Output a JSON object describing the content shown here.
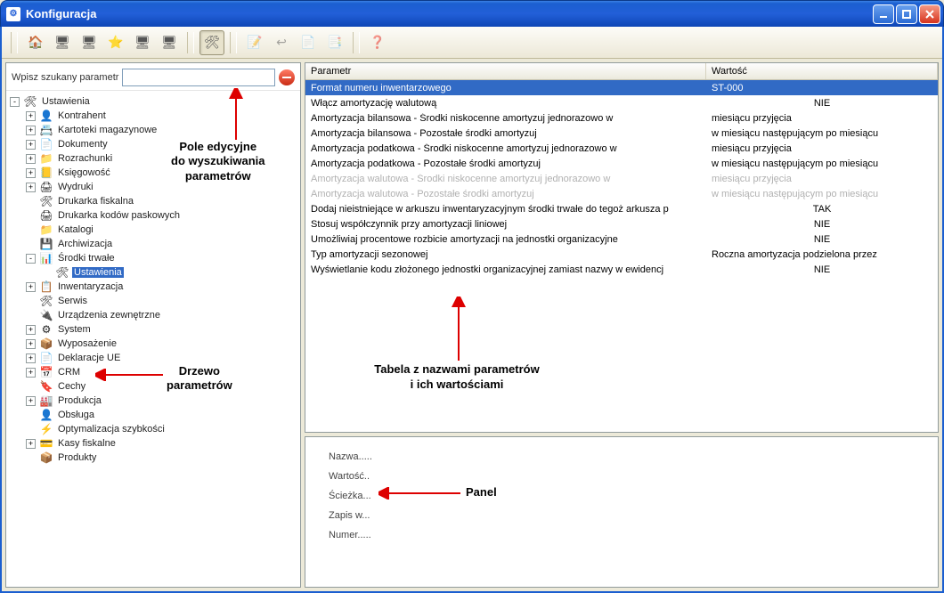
{
  "window": {
    "title": "Konfiguracja"
  },
  "search": {
    "label": "Wpisz szukany parametr",
    "value": ""
  },
  "tree": {
    "root": "Ustawienia",
    "items": [
      {
        "label": "Kontrahent",
        "icon": "👤",
        "exp": "+"
      },
      {
        "label": "Kartoteki magazynowe",
        "icon": "📇",
        "exp": "+"
      },
      {
        "label": "Dokumenty",
        "icon": "📄",
        "exp": "+"
      },
      {
        "label": "Rozrachunki",
        "icon": "📁",
        "exp": "+"
      },
      {
        "label": "Księgowość",
        "icon": "📒",
        "exp": "+"
      },
      {
        "label": "Wydruki",
        "icon": "🖨",
        "exp": "+"
      },
      {
        "label": "Drukarka fiskalna",
        "icon": "🛠",
        "exp": ""
      },
      {
        "label": "Drukarka kodów paskowych",
        "icon": "🖨",
        "exp": ""
      },
      {
        "label": "Katalogi",
        "icon": "📁",
        "exp": ""
      },
      {
        "label": "Archiwizacja",
        "icon": "💾",
        "exp": ""
      },
      {
        "label": "Środki trwałe",
        "icon": "📊",
        "exp": "-",
        "children": [
          {
            "label": "Ustawienia",
            "icon": "🛠",
            "selected": true
          }
        ]
      },
      {
        "label": "Inwentaryzacja",
        "icon": "📋",
        "exp": "+"
      },
      {
        "label": "Serwis",
        "icon": "🛠",
        "exp": ""
      },
      {
        "label": "Urządzenia zewnętrzne",
        "icon": "🔌",
        "exp": ""
      },
      {
        "label": "System",
        "icon": "⚙",
        "exp": "+"
      },
      {
        "label": "Wyposażenie",
        "icon": "📦",
        "exp": "+"
      },
      {
        "label": "Deklaracje UE",
        "icon": "📄",
        "exp": "+"
      },
      {
        "label": "CRM",
        "icon": "📅",
        "exp": "+"
      },
      {
        "label": "Cechy",
        "icon": "🔖",
        "exp": ""
      },
      {
        "label": "Produkcja",
        "icon": "🏭",
        "exp": "+"
      },
      {
        "label": "Obsługa",
        "icon": "👤",
        "exp": ""
      },
      {
        "label": "Optymalizacja szybkości",
        "icon": "⚡",
        "exp": ""
      },
      {
        "label": "Kasy fiskalne",
        "icon": "💳",
        "exp": "+"
      },
      {
        "label": "Produkty",
        "icon": "📦",
        "exp": ""
      }
    ]
  },
  "grid": {
    "headers": {
      "param": "Parametr",
      "value": "Wartość"
    },
    "rows": [
      {
        "p": "Format numeru inwentarzowego",
        "v": "ST-000",
        "sel": true
      },
      {
        "p": "Włącz amortyzację walutową",
        "v": "NIE",
        "center": true
      },
      {
        "p": "Amortyzacja bilansowa - Środki niskocenne amortyzuj jednorazowo w",
        "v": "miesiącu przyjęcia"
      },
      {
        "p": "Amortyzacja bilansowa - Pozostałe środki amortyzuj",
        "v": "w miesiącu następującym po miesiącu"
      },
      {
        "p": "Amortyzacja podatkowa  - Środki niskocenne amortyzuj jednorazowo w",
        "v": "miesiącu przyjęcia"
      },
      {
        "p": "Amortyzacja podatkowa  - Pozostałe środki amortyzuj",
        "v": "w miesiącu następującym po miesiącu"
      },
      {
        "p": "Amortyzacja walutowa - Środki niskocenne amortyzuj jednorazowo w",
        "v": "miesiącu przyjęcia",
        "disabled": true
      },
      {
        "p": "Amortyzacja walutowa - Pozostałe środki amortyzuj",
        "v": "w miesiącu następującym po miesiącu",
        "disabled": true
      },
      {
        "p": "Dodaj nieistniejące w arkuszu inwentaryzacyjnym środki trwałe do tegoż arkusza p",
        "v": "TAK",
        "center": true
      },
      {
        "p": "Stosuj współczynnik przy amortyzacji liniowej",
        "v": "NIE",
        "center": true
      },
      {
        "p": "Umożliwiaj procentowe rozbicie amortyzacji na jednostki organizacyjne",
        "v": "NIE",
        "center": true
      },
      {
        "p": "Typ amortyzacji sezonowej",
        "v": "Roczna amortyzacja podzielona przez"
      },
      {
        "p": "Wyświetlanie kodu złożonego jednostki organizacyjnej zamiast nazwy w ewidencj",
        "v": "NIE",
        "center": true
      }
    ]
  },
  "panel": {
    "name": "Nazwa.....",
    "value": "Wartość..",
    "path_label": "Ścieżka...",
    "save": "Zapis w...",
    "number": "Numer....."
  },
  "annotations": {
    "search": "Pole edycyjne do wyszukiwania parametrów",
    "tree": "Drzewo parametrów",
    "table": "Tabela z nazwami parametrów i ich wartościami",
    "panel": "Panel"
  },
  "toolbar_icons": [
    "🏠",
    "🖥",
    "🖥",
    "⭐",
    "🖥",
    "🖥",
    "🛠",
    "",
    "📝",
    "↩",
    "📄",
    "📑",
    "",
    "❓"
  ]
}
